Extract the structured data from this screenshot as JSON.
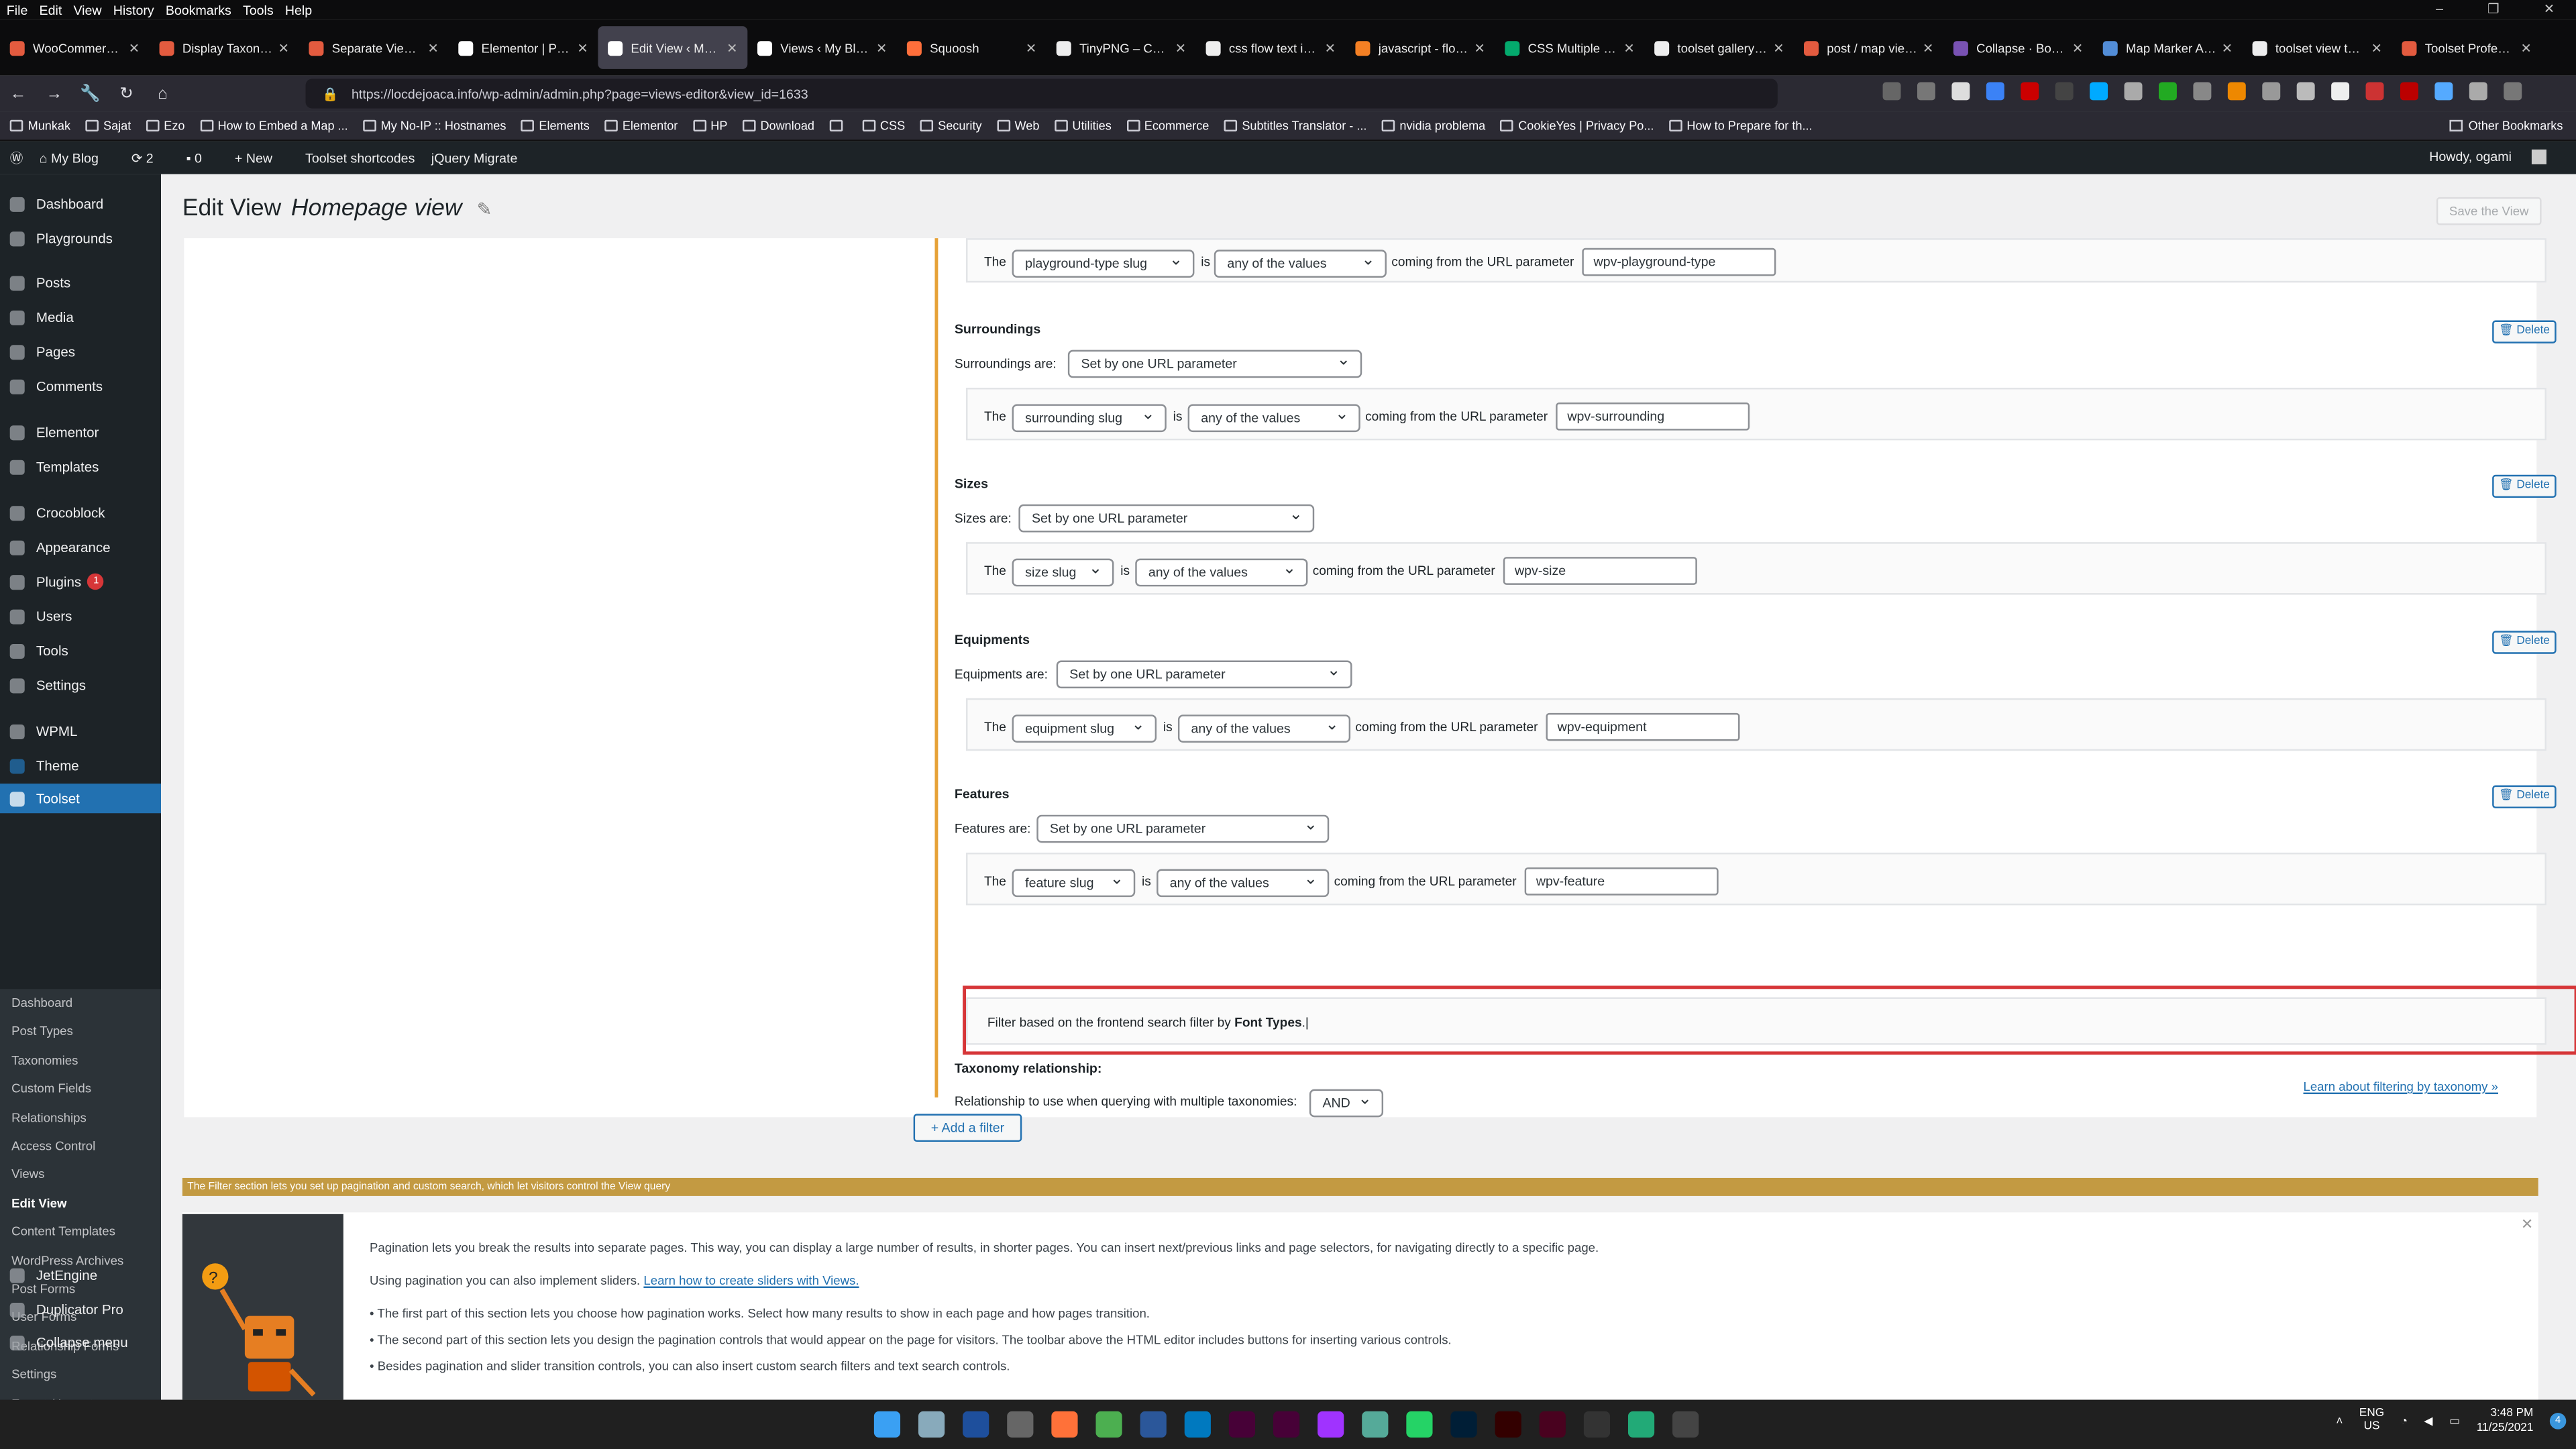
{
  "menubar": [
    "File",
    "Edit",
    "View",
    "History",
    "Bookmarks",
    "Tools",
    "Help"
  ],
  "tabs": [
    {
      "title": "WooCommerce P...",
      "color": "#e35b3f"
    },
    {
      "title": "Display Taxonomy...",
      "color": "#e35b3f"
    },
    {
      "title": "Separate Views ...",
      "color": "#e35b3f"
    },
    {
      "title": "Elementor | Prima pa...",
      "color": "#ffffff"
    },
    {
      "title": "Edit View ‹ My Blog ...",
      "color": "#ffffff"
    },
    {
      "title": "Views ‹ My Blog — W...",
      "color": "#ffffff"
    },
    {
      "title": "Squoosh",
      "color": "#ff6f3b"
    },
    {
      "title": "TinyPNG – Comp...",
      "color": "#eeeeee"
    },
    {
      "title": "css flow text into...",
      "color": "#eeeeee"
    },
    {
      "title": "javascript - flow ...",
      "color": "#f48024"
    },
    {
      "title": "CSS Multiple Col...",
      "color": "#04aa6d"
    },
    {
      "title": "toolset gallery - G...",
      "color": "#eeeeee"
    },
    {
      "title": "post / map view ...",
      "color": "#e35b3f"
    },
    {
      "title": "Collapse · Bootst...",
      "color": "#7952b3"
    },
    {
      "title": "Map Marker Alt |...",
      "color": "#528dd7"
    },
    {
      "title": "toolset view taxo...",
      "color": "#eeeeee"
    },
    {
      "title": "Toolset Professio...",
      "color": "#e35b3f"
    }
  ],
  "url": "https://locdejoaca.info/wp-admin/admin.php?page=views-editor&view_id=1633",
  "bookmarks": [
    "Munkak",
    "Sajat",
    "Ezo",
    "How to Embed a Map ...",
    "My No-IP :: Hostnames",
    "Elements",
    "Elementor",
    "HP",
    "Download",
    "",
    "CSS",
    "Security",
    "Web",
    "Utilities",
    "Ecommerce",
    "Subtitles Translator - ...",
    "nvidia problema",
    "CookieYes | Privacy Po...",
    "How to Prepare for th..."
  ],
  "other_bookmarks": "Other Bookmarks",
  "adminbar": {
    "site": "My Blog",
    "updates": "2",
    "comments": "0",
    "new": "New",
    "shortcodes": "Toolset shortcodes",
    "migrate": "jQuery Migrate",
    "howdy": "Howdy, ogami"
  },
  "sidebar": {
    "items": [
      "Dashboard",
      "Playgrounds",
      "Posts",
      "Media",
      "Pages",
      "Comments",
      "Elementor",
      "Templates",
      "Crocoblock",
      "Appearance",
      "Plugins",
      "Users",
      "Tools",
      "Settings",
      "WPML",
      "Theme",
      "Toolset",
      "JetEngine",
      "Duplicator Pro",
      "Collapse menu"
    ],
    "plugins_badge": "1",
    "submenu": [
      "Dashboard",
      "Post Types",
      "Taxonomies",
      "Custom Fields",
      "Relationships",
      "Access Control",
      "Views",
      "Edit View",
      "Content Templates",
      "WordPress Archives",
      "Post Forms",
      "User Forms",
      "Relationship Forms",
      "Settings",
      "Export / Import"
    ]
  },
  "page": {
    "title": "Edit View",
    "view_name": "Homepage view",
    "save": "Save the View"
  },
  "filters": {
    "playground": {
      "the": "The",
      "slug": "playground-type slug",
      "is": "is",
      "values": "any of the values",
      "coming": "coming from the URL parameter",
      "param": "wpv-playground-type"
    },
    "sections": [
      {
        "name": "Surroundings",
        "are": "Surroundings are:",
        "mode": "Set by one URL parameter",
        "the": "The",
        "slug": "surrounding slug",
        "is": "is",
        "values": "any of the values",
        "coming": "coming from the URL parameter",
        "param": "wpv-surrounding",
        "delete": "Delete"
      },
      {
        "name": "Sizes",
        "are": "Sizes are:",
        "mode": "Set by one URL parameter",
        "the": "The",
        "slug": "size slug",
        "is": "is",
        "values": "any of the values",
        "coming": "coming from the URL parameter",
        "param": "wpv-size",
        "delete": "Delete"
      },
      {
        "name": "Equipments",
        "are": "Equipments are:",
        "mode": "Set by one URL parameter",
        "the": "The",
        "slug": "equipment slug",
        "is": "is",
        "values": "any of the values",
        "coming": "coming from the URL parameter",
        "param": "wpv-equipment",
        "delete": "Delete"
      },
      {
        "name": "Features",
        "are": "Features are:",
        "mode": "Set by one URL parameter",
        "the": "The",
        "slug": "feature slug",
        "is": "is",
        "values": "any of the values",
        "coming": "coming from the URL parameter",
        "param": "wpv-feature",
        "delete": "Delete"
      }
    ],
    "font_filter_text": "Filter based on the frontend search filter by ",
    "font_filter_bold": "Font Types",
    "taxonomy_rel": "Taxonomy relationship:",
    "rel_text": "Relationship to use when querying with multiple taxonomies:",
    "rel_value": "AND",
    "learn": "Learn about filtering by taxonomy »",
    "add": "Add a filter"
  },
  "info_bar": "The Filter section lets you set up pagination and custom search, which let visitors control the View query",
  "help": [
    "Pagination lets you break the results into separate pages. This way, you can display a large number of results, in shorter pages. You can insert next/previous links and page selectors, for navigating directly to a specific page.",
    "Using pagination you can also implement sliders.",
    "Learn how to create sliders with Views.",
    "The first part of this section lets you choose how pagination works. Select how many results to show in each page and how pages transition.",
    "The second part of this section lets you design the pagination controls that would appear on the page for visitors. The toolbar above the HTML editor includes buttons for inserting various controls.",
    "Besides pagination and slider transition controls, you can also insert custom search filters and text search controls."
  ],
  "taskbar": {
    "lang": "ENG",
    "region": "US",
    "time": "3:48 PM",
    "date": "11/25/2021",
    "notif": "4"
  }
}
